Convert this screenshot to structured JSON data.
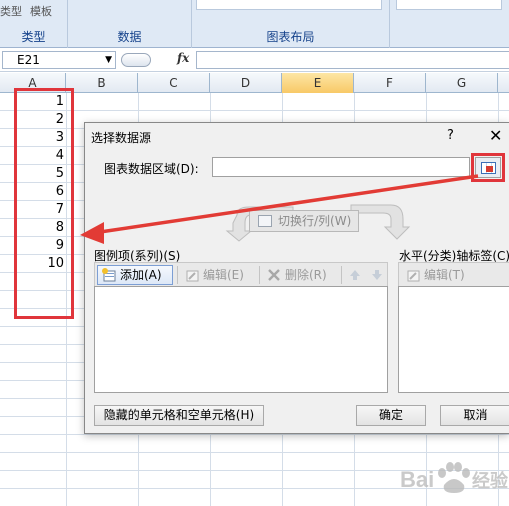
{
  "ribbon": {
    "top_items": [
      "类型",
      "模板"
    ],
    "groups": [
      "类型",
      "数据",
      "图表布局"
    ]
  },
  "formula_bar": {
    "name_box": "E21",
    "fx_label": "fx",
    "formula": ""
  },
  "columns": [
    "A",
    "B",
    "C",
    "D",
    "E",
    "F",
    "G"
  ],
  "active_column": "E",
  "cells_A": [
    "1",
    "2",
    "3",
    "4",
    "5",
    "6",
    "7",
    "8",
    "9",
    "10"
  ],
  "dialog": {
    "title": "选择数据源",
    "help": "?",
    "close": "✕",
    "range_label": "图表数据区域(D):",
    "range_value": "",
    "switch_label": "切换行/列(W)",
    "legend_label": "图例项(系列)(S)",
    "legend_buttons": {
      "add": "添加(A)",
      "edit": "编辑(E)",
      "delete": "删除(R)"
    },
    "axis_label": "水平(分类)轴标签(C)",
    "axis_edit": "编辑(T)",
    "hidden_cells": "隐藏的单元格和空单元格(H)",
    "ok": "确定",
    "cancel": "取消"
  },
  "colors": {
    "highlight_red": "#e0353b",
    "arrow_red": "#e23b35",
    "ribbon_blue": "#dfe9f5",
    "active_header": "#f8c967"
  },
  "watermark": "Bai 经验"
}
